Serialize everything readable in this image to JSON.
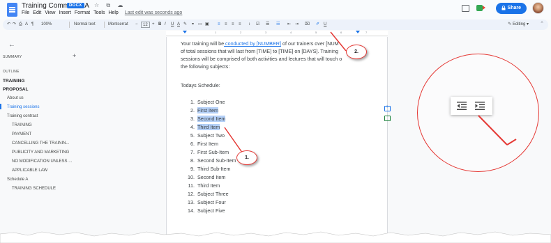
{
  "doc": {
    "title": "Training Comments-A",
    "badge": "DOCX",
    "title_icons": "☆ ⧉ ☁",
    "menu": [
      "File",
      "Edit",
      "View",
      "Insert",
      "Format",
      "Tools",
      "Help"
    ],
    "last_edit": "Last edit was seconds ago",
    "share_label": "Share"
  },
  "toolbar": {
    "zoom": "100%",
    "style": "Normal text",
    "font": "Montserrat",
    "font_size": "12",
    "editing_label": "Editing"
  },
  "sidebar": {
    "summary_label": "SUMMARY",
    "outline_label": "OUTLINE",
    "items": [
      {
        "label": "TRAINING",
        "level": "h1"
      },
      {
        "label": "PROPOSAL",
        "level": "h1"
      },
      {
        "label": "About us",
        "level": "h2"
      },
      {
        "label": "Training sessions",
        "level": "h2",
        "active": true
      },
      {
        "label": "Training contract",
        "level": "h2"
      },
      {
        "label": "TRAINING",
        "level": "h3"
      },
      {
        "label": "PAYMENT",
        "level": "h3"
      },
      {
        "label": "CANCELLING THE TRAININ...",
        "level": "h3"
      },
      {
        "label": "PUBLICITY AND MARKETING",
        "level": "h3"
      },
      {
        "label": "NO MODIFICATION UNLESS ...",
        "level": "h3"
      },
      {
        "label": "APPLICABLE LAW",
        "level": "h3"
      },
      {
        "label": "Schedule A",
        "level": "h2"
      },
      {
        "label": "TRAINING SCHEDULE",
        "level": "h3"
      }
    ]
  },
  "body": {
    "para1_a": "Your training will be",
    "para1_link1": " conducted by [NUMBER]",
    "para1_b": " of our trainers over [NUM",
    "para2": "of total sessions that will last from [TIME] to [TIME] on [DAYS]. Training",
    "para3": "sessions will be comprised of both activities and lectures that will touch o",
    "para4": "the following subjects:",
    "schedule_heading": "Todays Schedule:",
    "list": [
      {
        "num": "1.",
        "text": "Subject One",
        "highlight": false
      },
      {
        "num": "2.",
        "text": "First Item",
        "highlight": true
      },
      {
        "num": "3.",
        "text": "Second Item",
        "highlight": true
      },
      {
        "num": "4.",
        "text": "Third Item",
        "highlight": true
      },
      {
        "num": "5.",
        "text": "Subject Two",
        "highlight": false
      },
      {
        "num": "6.",
        "text": "First Item",
        "highlight": false
      },
      {
        "num": "7.",
        "text": "First Sub-Item",
        "highlight": false
      },
      {
        "num": "8.",
        "text": "Second Sub-Item",
        "highlight": false
      },
      {
        "num": "9.",
        "text": "Third Sub-Item",
        "highlight": false
      },
      {
        "num": "10.",
        "text": "Second Item",
        "highlight": false
      },
      {
        "num": "11.",
        "text": "Third Item",
        "highlight": false
      },
      {
        "num": "12.",
        "text": "Subject Three",
        "highlight": false
      },
      {
        "num": "13.",
        "text": "Subject Four",
        "highlight": false
      },
      {
        "num": "14.",
        "text": "Subject Five",
        "highlight": false
      }
    ]
  },
  "callouts": {
    "one": "1.",
    "two": "2."
  },
  "ruler_ticks": [
    "1",
    "2",
    "3",
    "4",
    "5",
    "6",
    "7"
  ],
  "colors": {
    "accent": "#1a73e8",
    "highlight": "#b4d0f7",
    "annotation_red": "#e53935"
  }
}
